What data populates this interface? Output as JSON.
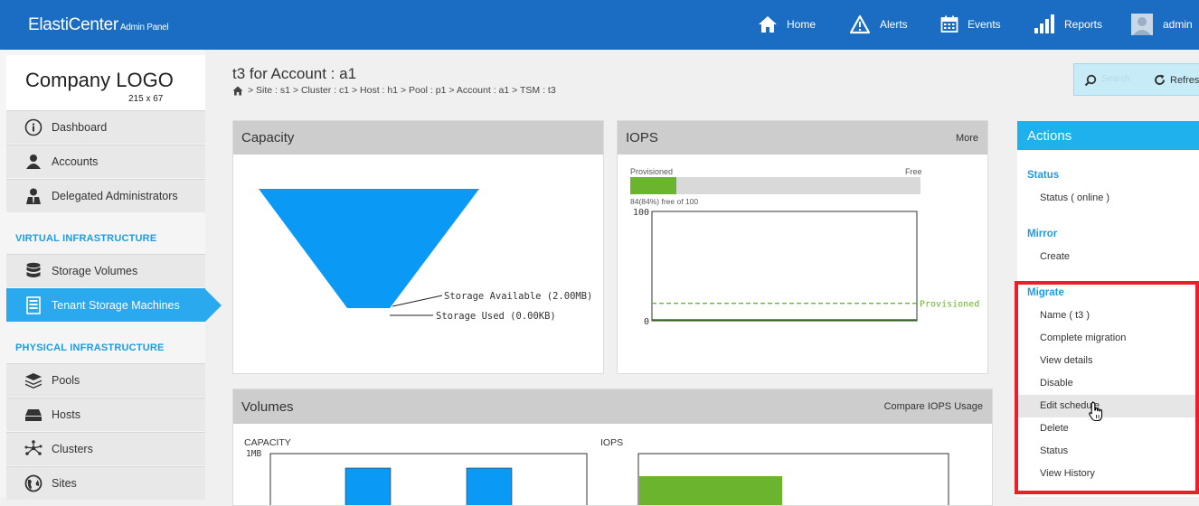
{
  "header": {
    "brand": "ElastiCenter",
    "brand_sub": "Admin Panel",
    "nav": [
      {
        "label": "Home",
        "icon": "home-icon"
      },
      {
        "label": "Alerts",
        "icon": "alert-icon"
      },
      {
        "label": "Events",
        "icon": "calendar-icon"
      },
      {
        "label": "Reports",
        "icon": "bar-chart-icon"
      },
      {
        "label": "admin",
        "icon": "user-avatar-icon"
      }
    ]
  },
  "sidebar": {
    "logo_text": "Company LOGO",
    "logo_size": "215 x 67",
    "items": [
      {
        "label": "Dashboard",
        "icon": "info-icon"
      },
      {
        "label": "Accounts",
        "icon": "user-icon"
      },
      {
        "label": "Delegated Administrators",
        "icon": "admin-user-icon"
      },
      {
        "label": "Storage Volumes",
        "icon": "database-icon"
      },
      {
        "label": "Tenant Storage Machines",
        "icon": "tsm-icon"
      },
      {
        "label": "Pools",
        "icon": "layers-icon"
      },
      {
        "label": "Hosts",
        "icon": "host-icon"
      },
      {
        "label": "Clusters",
        "icon": "cluster-icon"
      },
      {
        "label": "Sites",
        "icon": "globe-icon"
      }
    ],
    "sections": [
      "VIRTUAL INFRASTRUCTURE",
      "PHYSICAL INFRASTRUCTURE"
    ]
  },
  "main": {
    "title": "t3 for Account : a1",
    "breadcrumb": "> Site : s1 > Cluster : c1 > Host : h1 > Pool : p1 > Account : a1 > TSM : t3",
    "search_placeholder": "Search",
    "refresh_label": "Refresh"
  },
  "capacity": {
    "title": "Capacity",
    "label_available": "Storage Available (2.00MB)",
    "label_used": "Storage Used (0.00KB)"
  },
  "iops": {
    "title": "IOPS",
    "more": "More",
    "provisioned_label": "Provisioned",
    "free_label": "Free",
    "bar_fill_fraction": 0.16,
    "summary": "84(84%) free of 100",
    "y_max": "100",
    "y_min": "0",
    "line_label": "Provisioned",
    "provisioned_value": 16
  },
  "volumes": {
    "title": "Volumes",
    "compare_link": "Compare IOPS Usage",
    "capacity_label": "CAPACITY",
    "capacity_unit": "1MB",
    "iops_label": "IOPS"
  },
  "actions": {
    "title": "Actions",
    "groups": [
      "Status",
      "Mirror",
      "Migrate"
    ],
    "status_items": [
      "Status ( online )"
    ],
    "mirror_items": [
      "Create"
    ],
    "migrate_items": [
      "Name ( t3 )",
      "Complete migration",
      "View details",
      "Disable",
      "Edit schedule",
      "Delete",
      "Status",
      "View History"
    ]
  },
  "colors": {
    "header": "#1a6dc2",
    "accent": "#2aa9ee",
    "actions_header": "#1fb0ee",
    "chart_blue": "#0a9af5",
    "green": "#6ab42e",
    "highlight_red": "#e8202a"
  }
}
